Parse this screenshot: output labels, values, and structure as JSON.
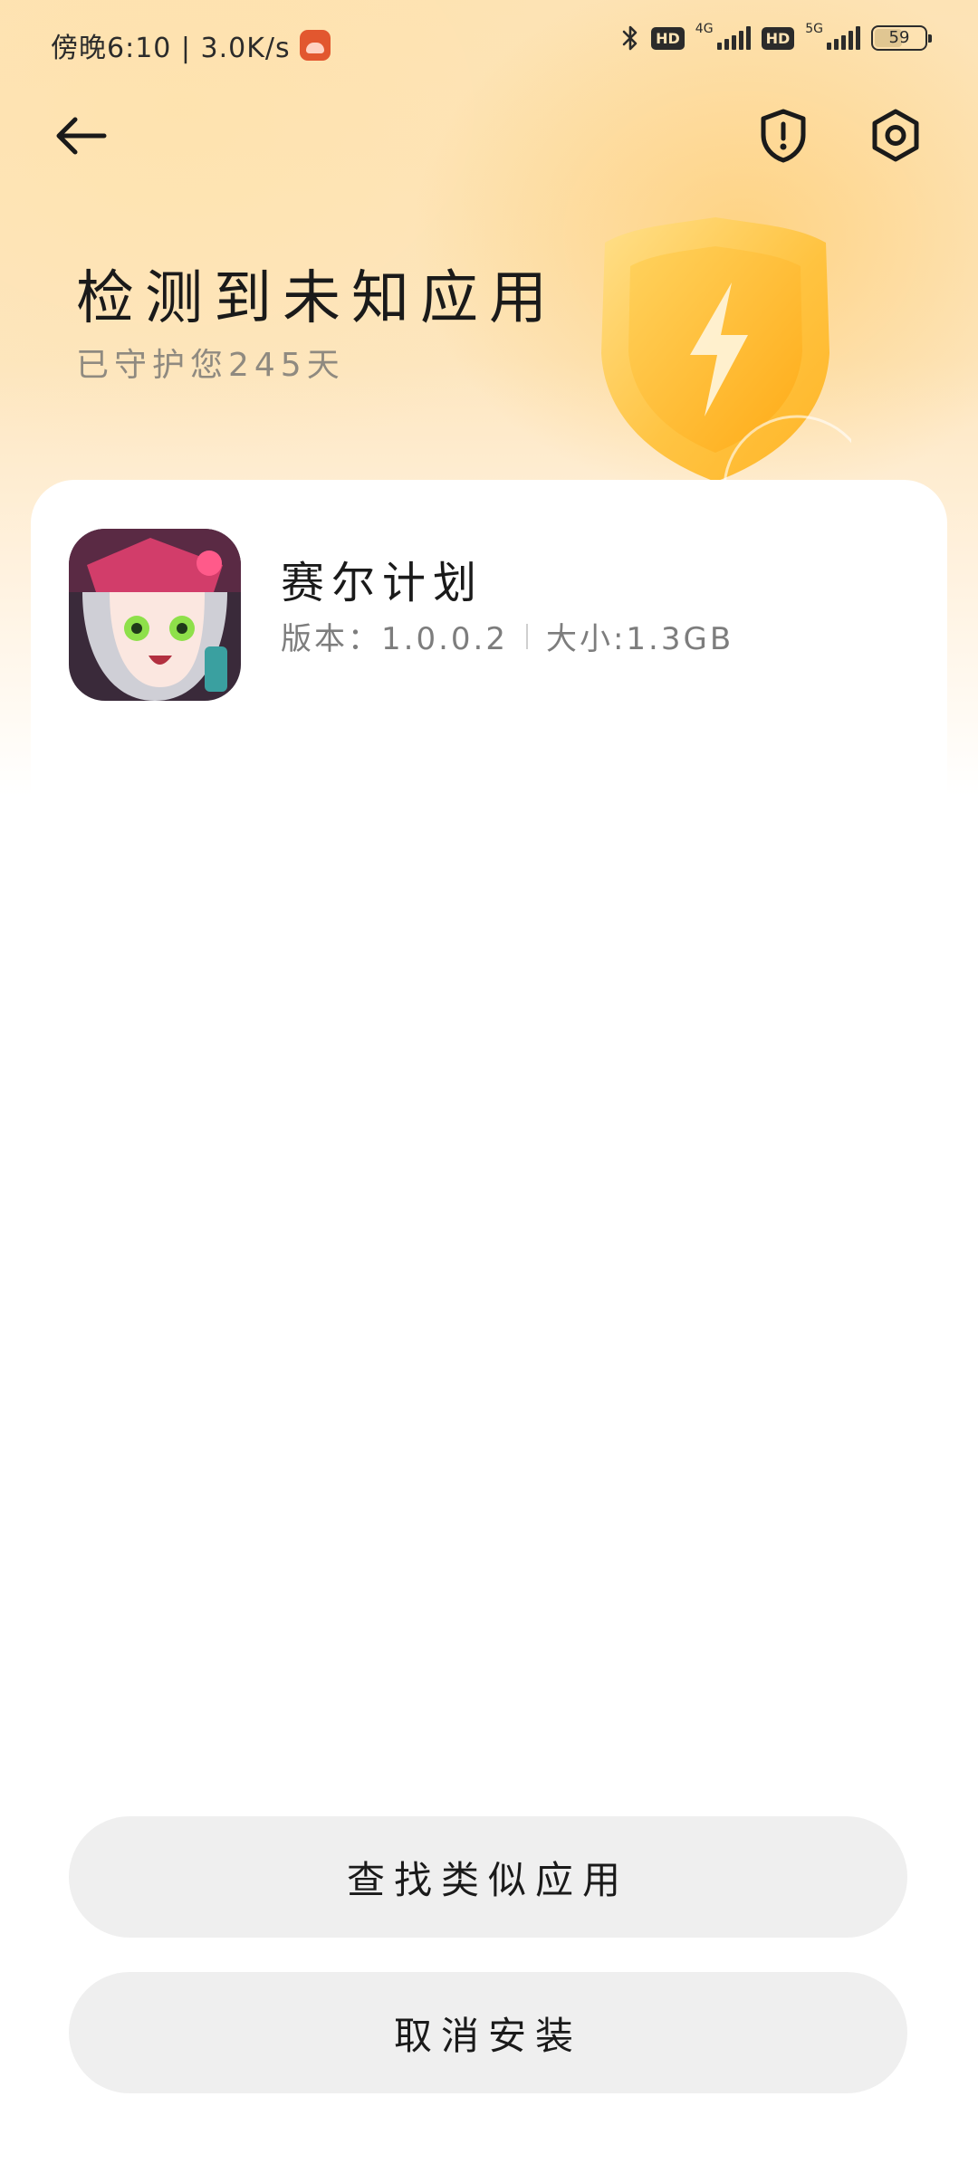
{
  "status_bar": {
    "time_text": "傍晚6:10 | 3.0K/s",
    "net_1": "4G",
    "net_2": "5G",
    "hd_label": "HD",
    "battery": "59",
    "battery_level": 0.59,
    "icons": [
      "bluetooth-icon",
      "signal-icon",
      "battery-icon"
    ]
  },
  "nav": {
    "back_icon": "arrow-left-icon",
    "shield_icon": "shield-alert-icon",
    "settings_icon": "settings-gear-icon"
  },
  "header": {
    "title": "检测到未知应用",
    "subtitle": "已守护您245天"
  },
  "app": {
    "name": "赛尔计划",
    "version": "版本：1.0.0.2",
    "size": "大小:1.3GB"
  },
  "buttons": {
    "find_similar": "查找类似应用",
    "cancel_install": "取消安装"
  },
  "colors": {
    "header_bg": "#fde3b5",
    "accent": "#ffc24a",
    "button_bg": "#efefef",
    "text_primary": "#1a1a1a",
    "text_secondary": "#8f8a80"
  }
}
